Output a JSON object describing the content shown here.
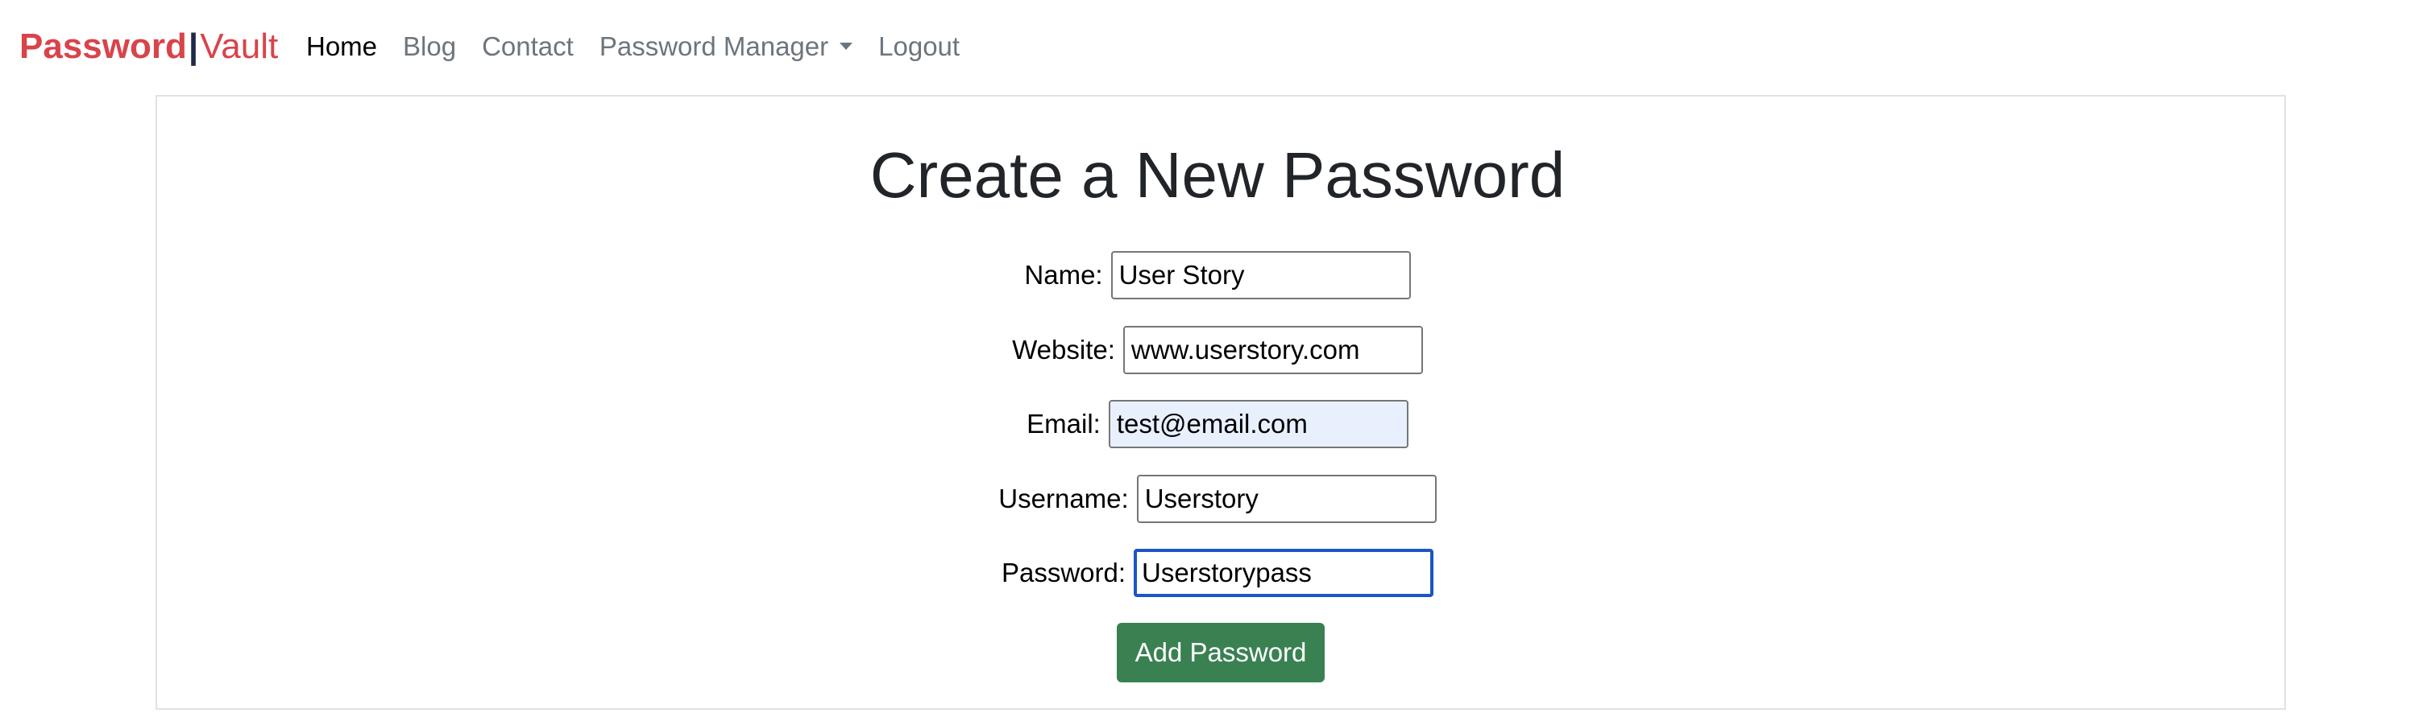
{
  "brand": {
    "part1": "Password",
    "separator": "|",
    "part2": "Vault",
    "color": "#d9434a"
  },
  "nav": {
    "home": "Home",
    "blog": "Blog",
    "contact": "Contact",
    "password_manager": "Password Manager",
    "logout": "Logout"
  },
  "form": {
    "title": "Create a New Password",
    "name_label": "Name:",
    "name_value": "User Story",
    "website_label": "Website:",
    "website_value": "www.userstory.com",
    "email_label": "Email:",
    "email_value": "test@email.com",
    "username_label": "Username:",
    "username_value": "Userstory",
    "password_label": "Password:",
    "password_value": "Userstorypass",
    "submit_label": "Add Password",
    "submit_color": "#3a8152"
  }
}
